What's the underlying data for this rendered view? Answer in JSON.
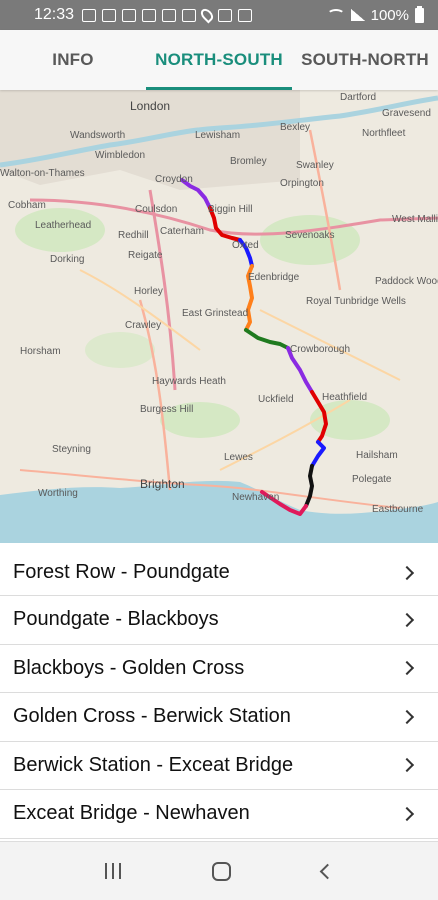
{
  "status_bar": {
    "time": "12:33",
    "battery_pct": "100%",
    "icons": [
      "mail-icon",
      "m-notification-icon",
      "gallery-icon",
      "news-icon",
      "calendar-icon",
      "youtube-icon",
      "location-icon",
      "excel-icon",
      "sim-icon",
      "wifi-icon",
      "signal-icon",
      "battery-icon"
    ]
  },
  "tabs": [
    {
      "label": "INFO",
      "active": false
    },
    {
      "label": "NORTH-SOUTH",
      "active": true
    },
    {
      "label": "SOUTH-NORTH",
      "active": false
    }
  ],
  "map": {
    "place_labels": [
      "London",
      "Wimbledon",
      "Croydon",
      "Coulsdon",
      "Biggin Hill",
      "Caterham",
      "Oxted",
      "Edenbridge",
      "Sevenoaks",
      "Reigate",
      "Horley",
      "Crawley",
      "East Grinstead",
      "Royal Tunbridge Wells",
      "Crowborough",
      "Haywards Heath",
      "Burgess Hill",
      "Uckfield",
      "Heathfield",
      "Lewes",
      "Brighton",
      "Newhaven",
      "Hailsham",
      "Polegate",
      "Eastbourne",
      "Horsham",
      "Dorking",
      "Leatherhead",
      "Cobham",
      "Walton-on-Thames",
      "Wandsworth",
      "Lewisham",
      "Bromley",
      "Orpington",
      "Swanley",
      "West Malling",
      "Paddock Wood",
      "Steyning",
      "Worthing",
      "Gravesend",
      "Northfleet",
      "Bexley",
      "Dartford",
      "Redhill"
    ],
    "accent_colors": [
      "#8a2be2",
      "#e00000",
      "#1a1aff",
      "#ff7f1a",
      "#1f7a1f",
      "#111111",
      "#e0195a"
    ]
  },
  "routes": [
    {
      "label": "Forest Row - Poundgate"
    },
    {
      "label": "Poundgate - Blackboys"
    },
    {
      "label": "Blackboys - Golden Cross"
    },
    {
      "label": "Golden Cross - Berwick Station"
    },
    {
      "label": "Berwick Station - Exceat Bridge"
    },
    {
      "label": "Exceat Bridge - Newhaven"
    }
  ],
  "colors": {
    "accent": "#1a8e7c"
  }
}
